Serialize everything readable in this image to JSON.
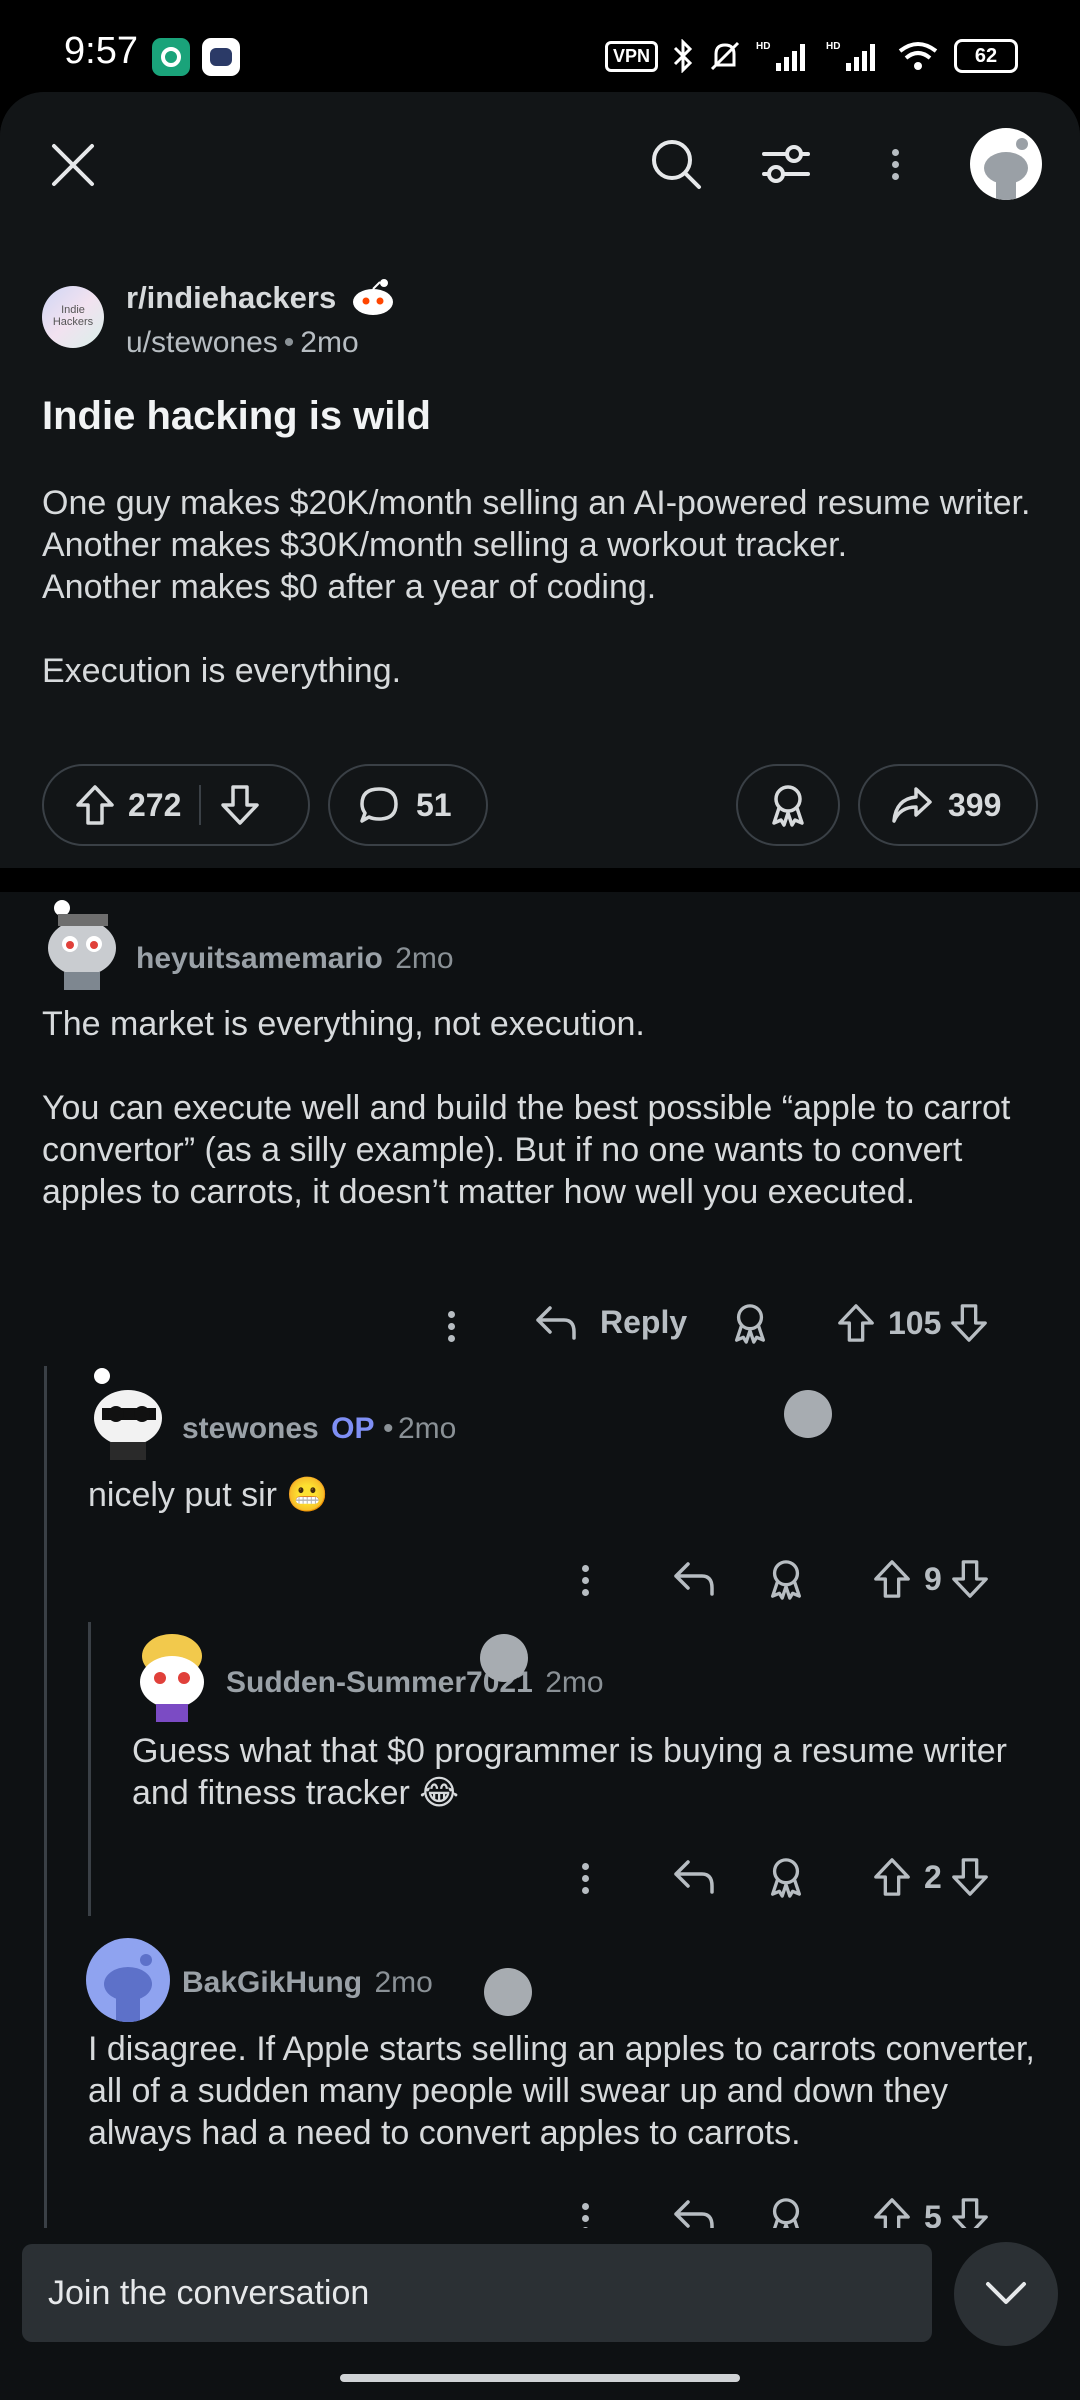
{
  "status_bar": {
    "time": "9:57",
    "vpn": "VPN",
    "battery": "62"
  },
  "toolbar": {
    "close_icon": "close-icon",
    "search_icon": "search-icon",
    "filter_icon": "filter-icon",
    "more_icon": "more-vertical-icon"
  },
  "post": {
    "subreddit": "r/indiehackers",
    "subreddit_avatar_text": "Indie Hackers",
    "author": "u/stewones",
    "age": "2mo",
    "title": "Indie hacking is wild",
    "body_lines": [
      "One guy makes $20K/month selling an AI-powered resume writer.",
      "Another makes $30K/month selling a workout tracker.",
      "Another makes $0 after a year of coding.",
      "",
      "Execution is everything."
    ],
    "upvotes": "272",
    "comments": "51",
    "shares": "399"
  },
  "comments": [
    {
      "user": "heyuitsamemario",
      "age": "2mo",
      "text": [
        "The market is everything, not execution.",
        "",
        "You can execute well and build the best possible “apple to carrot convertor” (as a silly example). But if no one wants to convert apples to carrots, it doesn’t matter how well you executed."
      ],
      "reply_label": "Reply",
      "votes": "105"
    },
    {
      "user": "stewones",
      "op_badge": "OP",
      "age": "2mo",
      "text": "nicely put sir 😬",
      "votes": "9"
    },
    {
      "user": "Sudden-Summer7021",
      "age": "2mo",
      "text": "Guess what that $0 programmer is buying a resume writer and fitness tracker 😂",
      "votes": "2"
    },
    {
      "user": "BakGikHung",
      "age": "2mo",
      "text": "I disagree. If Apple starts selling an apples to carrots converter, all of a sudden many people will swear up and down they always had a need to convert apples to carrots.",
      "votes": "5"
    }
  ],
  "composer": {
    "placeholder": "Join the conversation"
  }
}
